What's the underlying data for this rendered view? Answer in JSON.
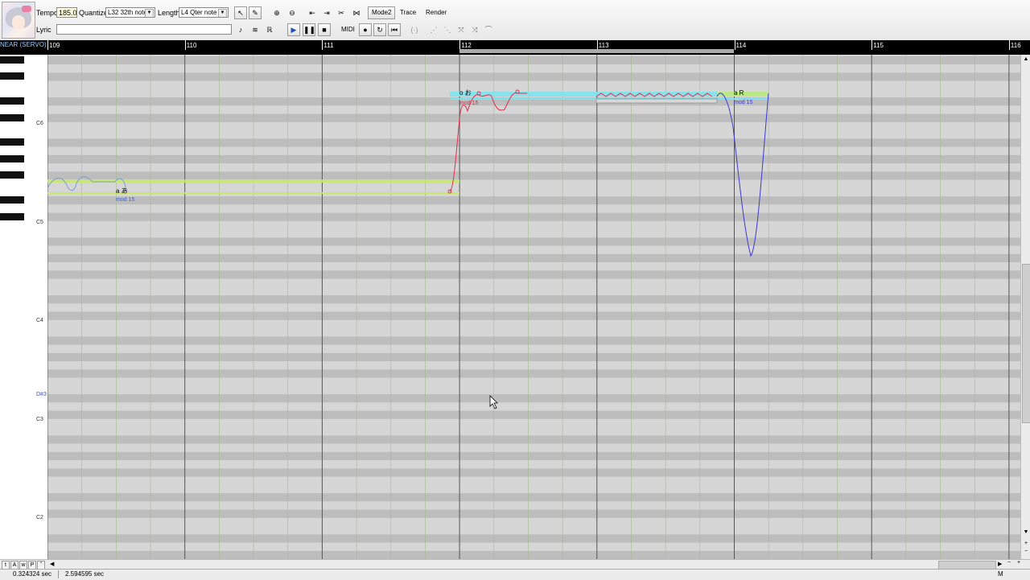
{
  "toolbar": {
    "tempo_label": "Tempo",
    "tempo_value": "185.0",
    "quantize_label": "Quantize",
    "quantize_value": "L32 32th note",
    "length_label": "Length",
    "length_value": "L4  Qter note",
    "mode_label": "Mode2",
    "trace_label": "Trace",
    "render_label": "Render",
    "lyric_label": "Lyric",
    "lyric_value": "",
    "midi_label": "MIDI"
  },
  "ruler": {
    "track_name": "NEAR (SERVO)",
    "bars": [
      "109",
      "110",
      "111",
      "112",
      "113",
      "114",
      "115",
      "116"
    ]
  },
  "piano": {
    "labels": [
      "C6",
      "C5",
      "C4",
      "D#3",
      "C3",
      "C2"
    ]
  },
  "notes": {
    "n1_lyric": "a あ",
    "n1_mod": "mod 15",
    "n2_lyric": "o お",
    "n2_mod": "mod 15",
    "n3_lyric": "a R",
    "n3_mod": "mod 15"
  },
  "status": {
    "time_left": "0.324324 sec",
    "time_right": "2.594595 sec",
    "mode_letter": "M"
  },
  "colors": {
    "note_green": "#c8e86a",
    "note_cyan": "#7de3f0",
    "pitch_red": "#e0304a",
    "pitch_blue": "#3a3ad0"
  }
}
